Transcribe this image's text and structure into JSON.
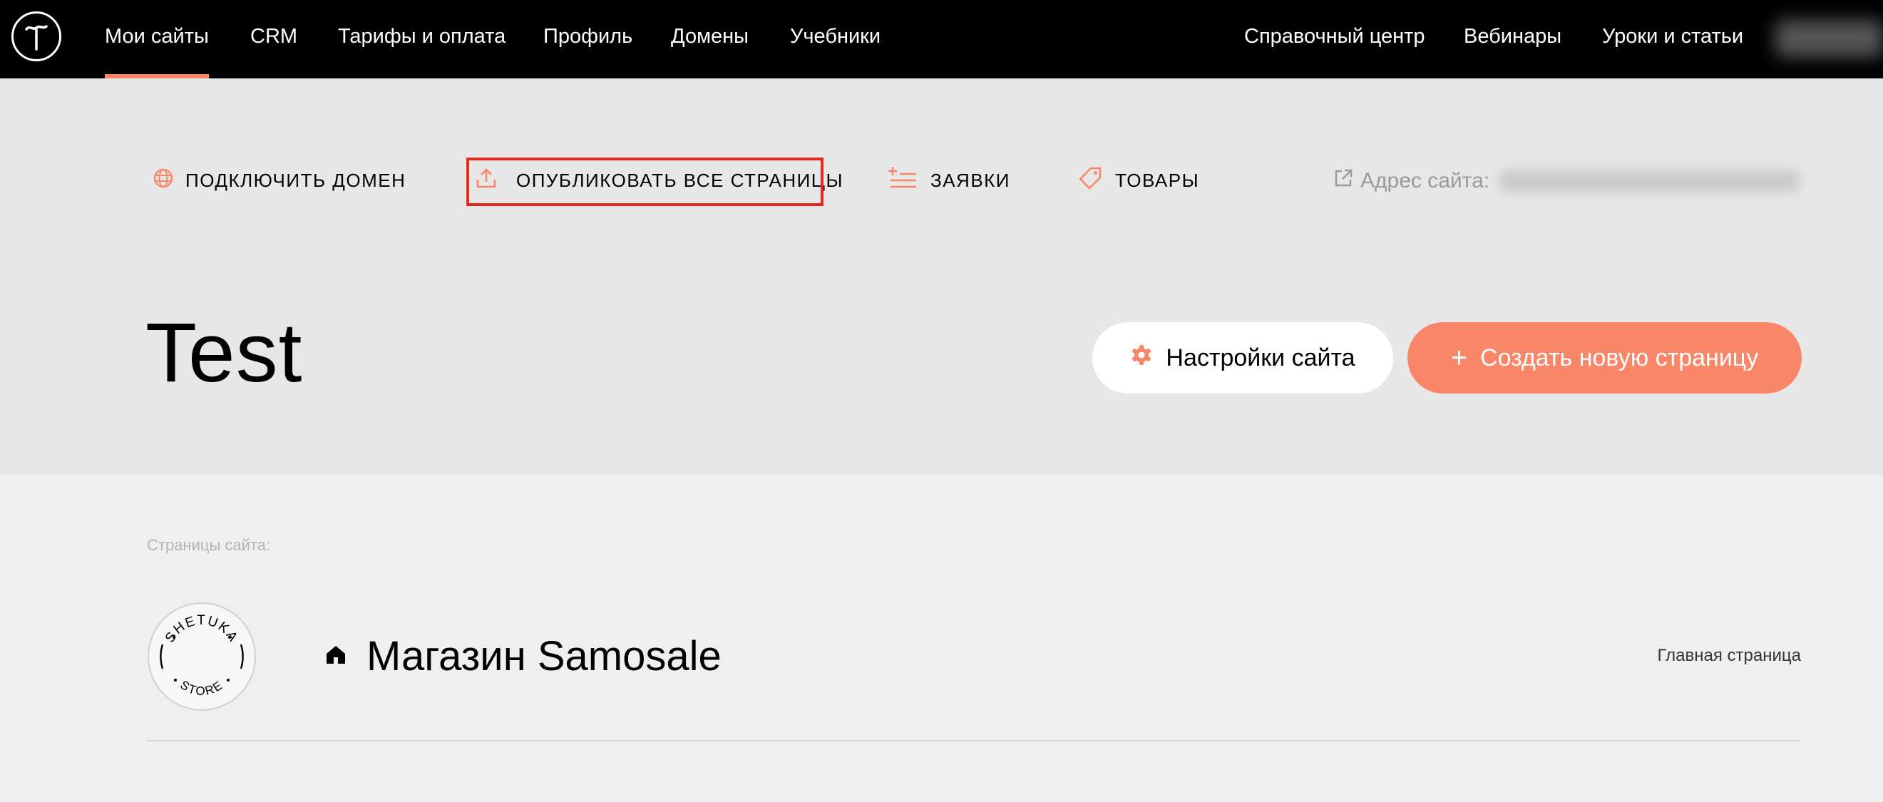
{
  "topnav": {
    "left": [
      "Мои сайты",
      "CRM",
      "Тарифы и оплата",
      "Профиль",
      "Домены",
      "Учебники"
    ],
    "right": [
      "Справочный центр",
      "Вебинары",
      "Уроки и статьи"
    ],
    "active_index": 0
  },
  "actions": {
    "connect_domain": "ПОДКЛЮЧИТЬ ДОМЕН",
    "publish_all": "ОПУБЛИКОВАТЬ ВСЕ СТРАНИЦЫ",
    "requests": "ЗАЯВКИ",
    "products": "ТОВАРЫ",
    "site_address_label": "Адрес сайта:"
  },
  "site": {
    "title": "Test",
    "settings_button": "Настройки сайта",
    "create_button": "Создать новую страницу"
  },
  "pages": {
    "label": "Страницы сайта:",
    "items": [
      {
        "title": "Магазин Samosale",
        "meta": "Главная страница",
        "thumb_text_top": "SHETUKA",
        "thumb_text_bottom": "STORE"
      }
    ]
  },
  "colors": {
    "accent": "#fa8669",
    "topbar": "#000000",
    "header_bg": "#e7e7e7",
    "page_bg": "#efefef",
    "highlight": "#e8281a"
  },
  "icons": {
    "connect_domain": "globe-icon",
    "publish_all": "upload-icon",
    "requests": "list-plus-icon",
    "products": "tag-icon",
    "site_address": "external-link-icon",
    "settings": "gear-icon",
    "home": "home-icon"
  }
}
